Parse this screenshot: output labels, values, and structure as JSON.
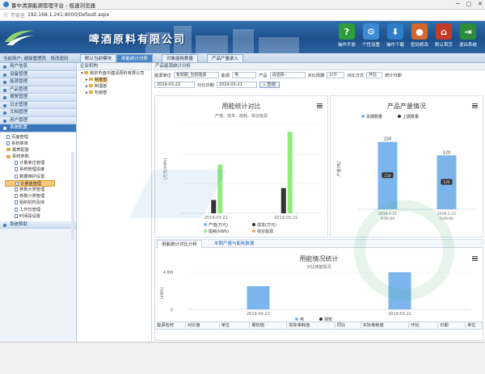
{
  "window": {
    "title": "鲁中清源能源管理平台 - 极速浏览器",
    "controls": [
      "─",
      "□",
      "✕"
    ]
  },
  "address": {
    "security": "不安全",
    "url": "192.168.1.241:8000/Default.aspx"
  },
  "header": {
    "company": "啤酒原料有限公司",
    "toolbar": [
      {
        "label": "操作手册",
        "icon": "?",
        "color": "#2e9d3a"
      },
      {
        "label": "个性设置",
        "icon": "⚙",
        "color": "#3c8ad6"
      },
      {
        "label": "操作下载",
        "icon": "⬇",
        "color": "#2f7ec9"
      },
      {
        "label": "密码修改",
        "icon": "●",
        "color": "#d5662e"
      },
      {
        "label": "默认首页",
        "icon": "⌂",
        "color": "#c33a2a"
      },
      {
        "label": "退出系统",
        "icon": "⇥",
        "color": "#2d8c3c"
      }
    ]
  },
  "navbar": {
    "user": "当前用户: 超级管理员　修改密码",
    "tabs": [
      "默认当前模块",
      "用能统计分析",
      "对象能耗数量",
      "产品产量录入"
    ],
    "active_tab": 1
  },
  "sidebar": {
    "items": [
      "用户信息",
      "设备管理",
      "能源管理",
      "产品管理",
      "报警管理",
      "日志管理",
      "文档管理",
      "用户管理",
      "系统配置",
      "系统帮助"
    ],
    "open_index": 8,
    "tree": [
      "页面管理",
      "系统菜单",
      "报表配置",
      "系统参数",
      "计量单位管理",
      "系统管理清度",
      "数据维护设置",
      "计量值管理",
      "参数大类管理",
      "参数小类管理",
      "组织机构及库",
      "工作日管理",
      "时间段设置"
    ],
    "selected_tree": 7
  },
  "org": {
    "header": "企业机构",
    "nodes": [
      "南京市盘中建清原料有限公司",
      "制麦部",
      "制酒部",
      "包装部"
    ]
  },
  "main": {
    "header": "产品能源统计分析",
    "filters": {
      "level_label": "能源单位",
      "level_value": "有效期_当前能源",
      "range_label": "能源",
      "range_value": "电",
      "product_label": "产品",
      "product_value": "请选择--",
      "stat_label": "对比周期",
      "stat_value": "公斤",
      "compare_label": "对比方式",
      "compare_value": "环比",
      "date_label": "统计日期"
    },
    "date_start": "2019-03-22",
    "date_mid_label": "对比日期",
    "date_end": "2019-03-21",
    "query": "查询"
  },
  "chart_left": {
    "title": "用能统计对比",
    "subtitle": "产值、成本、能耗、综合能源",
    "ylabel": "(万元/kWh)",
    "legend": [
      "产值(万元)",
      "成本(万元)",
      "能耗(kWh)",
      "综合能源"
    ],
    "colors": [
      "#7cb5ec",
      "#333333",
      "#90ed7d",
      "#f7a35c"
    ]
  },
  "chart_right": {
    "title": "产品产量情况",
    "legend": [
      "本期数量",
      "上期数量"
    ],
    "ylabel": "产量(吨)",
    "colors": [
      "#7cb5ec",
      "#333333"
    ]
  },
  "chart_bottom": {
    "title": "用能情况统计",
    "subtitle": "对比用能情况",
    "y_tick": "4.8M",
    "y_tick2": "0",
    "ylabel": "(kWh)",
    "legend": [
      "电",
      "煤炭"
    ],
    "colors": [
      "#7cb5ec",
      "#333333"
    ]
  },
  "bottom_tabs": [
    "用能统计对比分析",
    "本期产量与能耗数据"
  ],
  "table_headers": [
    "能源名称",
    "对比值",
    "单位",
    "期初值",
    "实际单耗值",
    "同比",
    "实际单耗值",
    "环比",
    "日期",
    "单位"
  ],
  "chart_data": [
    {
      "type": "bar",
      "title": "用能统计对比",
      "subtitle": "产值、成本、能耗、综合能源",
      "ylabel": "(万元/kWh)",
      "categories": [
        "2019-03-22",
        "2019-03-21"
      ],
      "series": [
        {
          "name": "产值(万元)",
          "values": [
            0,
            0
          ]
        },
        {
          "name": "成本(万元)",
          "values": [
            90,
            170
          ]
        },
        {
          "name": "能耗(kWh)",
          "values": [
            330,
            550
          ]
        },
        {
          "name": "综合能源",
          "values": [
            0,
            0
          ]
        }
      ],
      "ylim": [
        0,
        600
      ]
    },
    {
      "type": "bar",
      "title": "产品产量情况",
      "ylabel": "产量(吨)",
      "categories": [
        "2019-1-21 0:00:00",
        "2019-1-22 0:00:00"
      ],
      "series": [
        {
          "name": "本期数量",
          "values": [
            150,
            120
          ]
        },
        {
          "name": "上期数量",
          "values": [
            0,
            0
          ]
        }
      ],
      "bar_labels": [
        "150",
        "120"
      ],
      "inner_labels": [
        "150",
        "120"
      ],
      "ylim": [
        0,
        180
      ]
    },
    {
      "type": "bar",
      "title": "用能情况统计",
      "subtitle": "对比用能情况",
      "ylabel": "(kWh)",
      "categories": [
        "2019-03-22",
        "2019-03-21"
      ],
      "series": [
        {
          "name": "电",
          "values": [
            3.0,
            4.8
          ]
        },
        {
          "name": "煤炭",
          "values": [
            0,
            0
          ]
        }
      ],
      "unit": "M",
      "ylim": [
        0,
        4.8
      ]
    }
  ]
}
